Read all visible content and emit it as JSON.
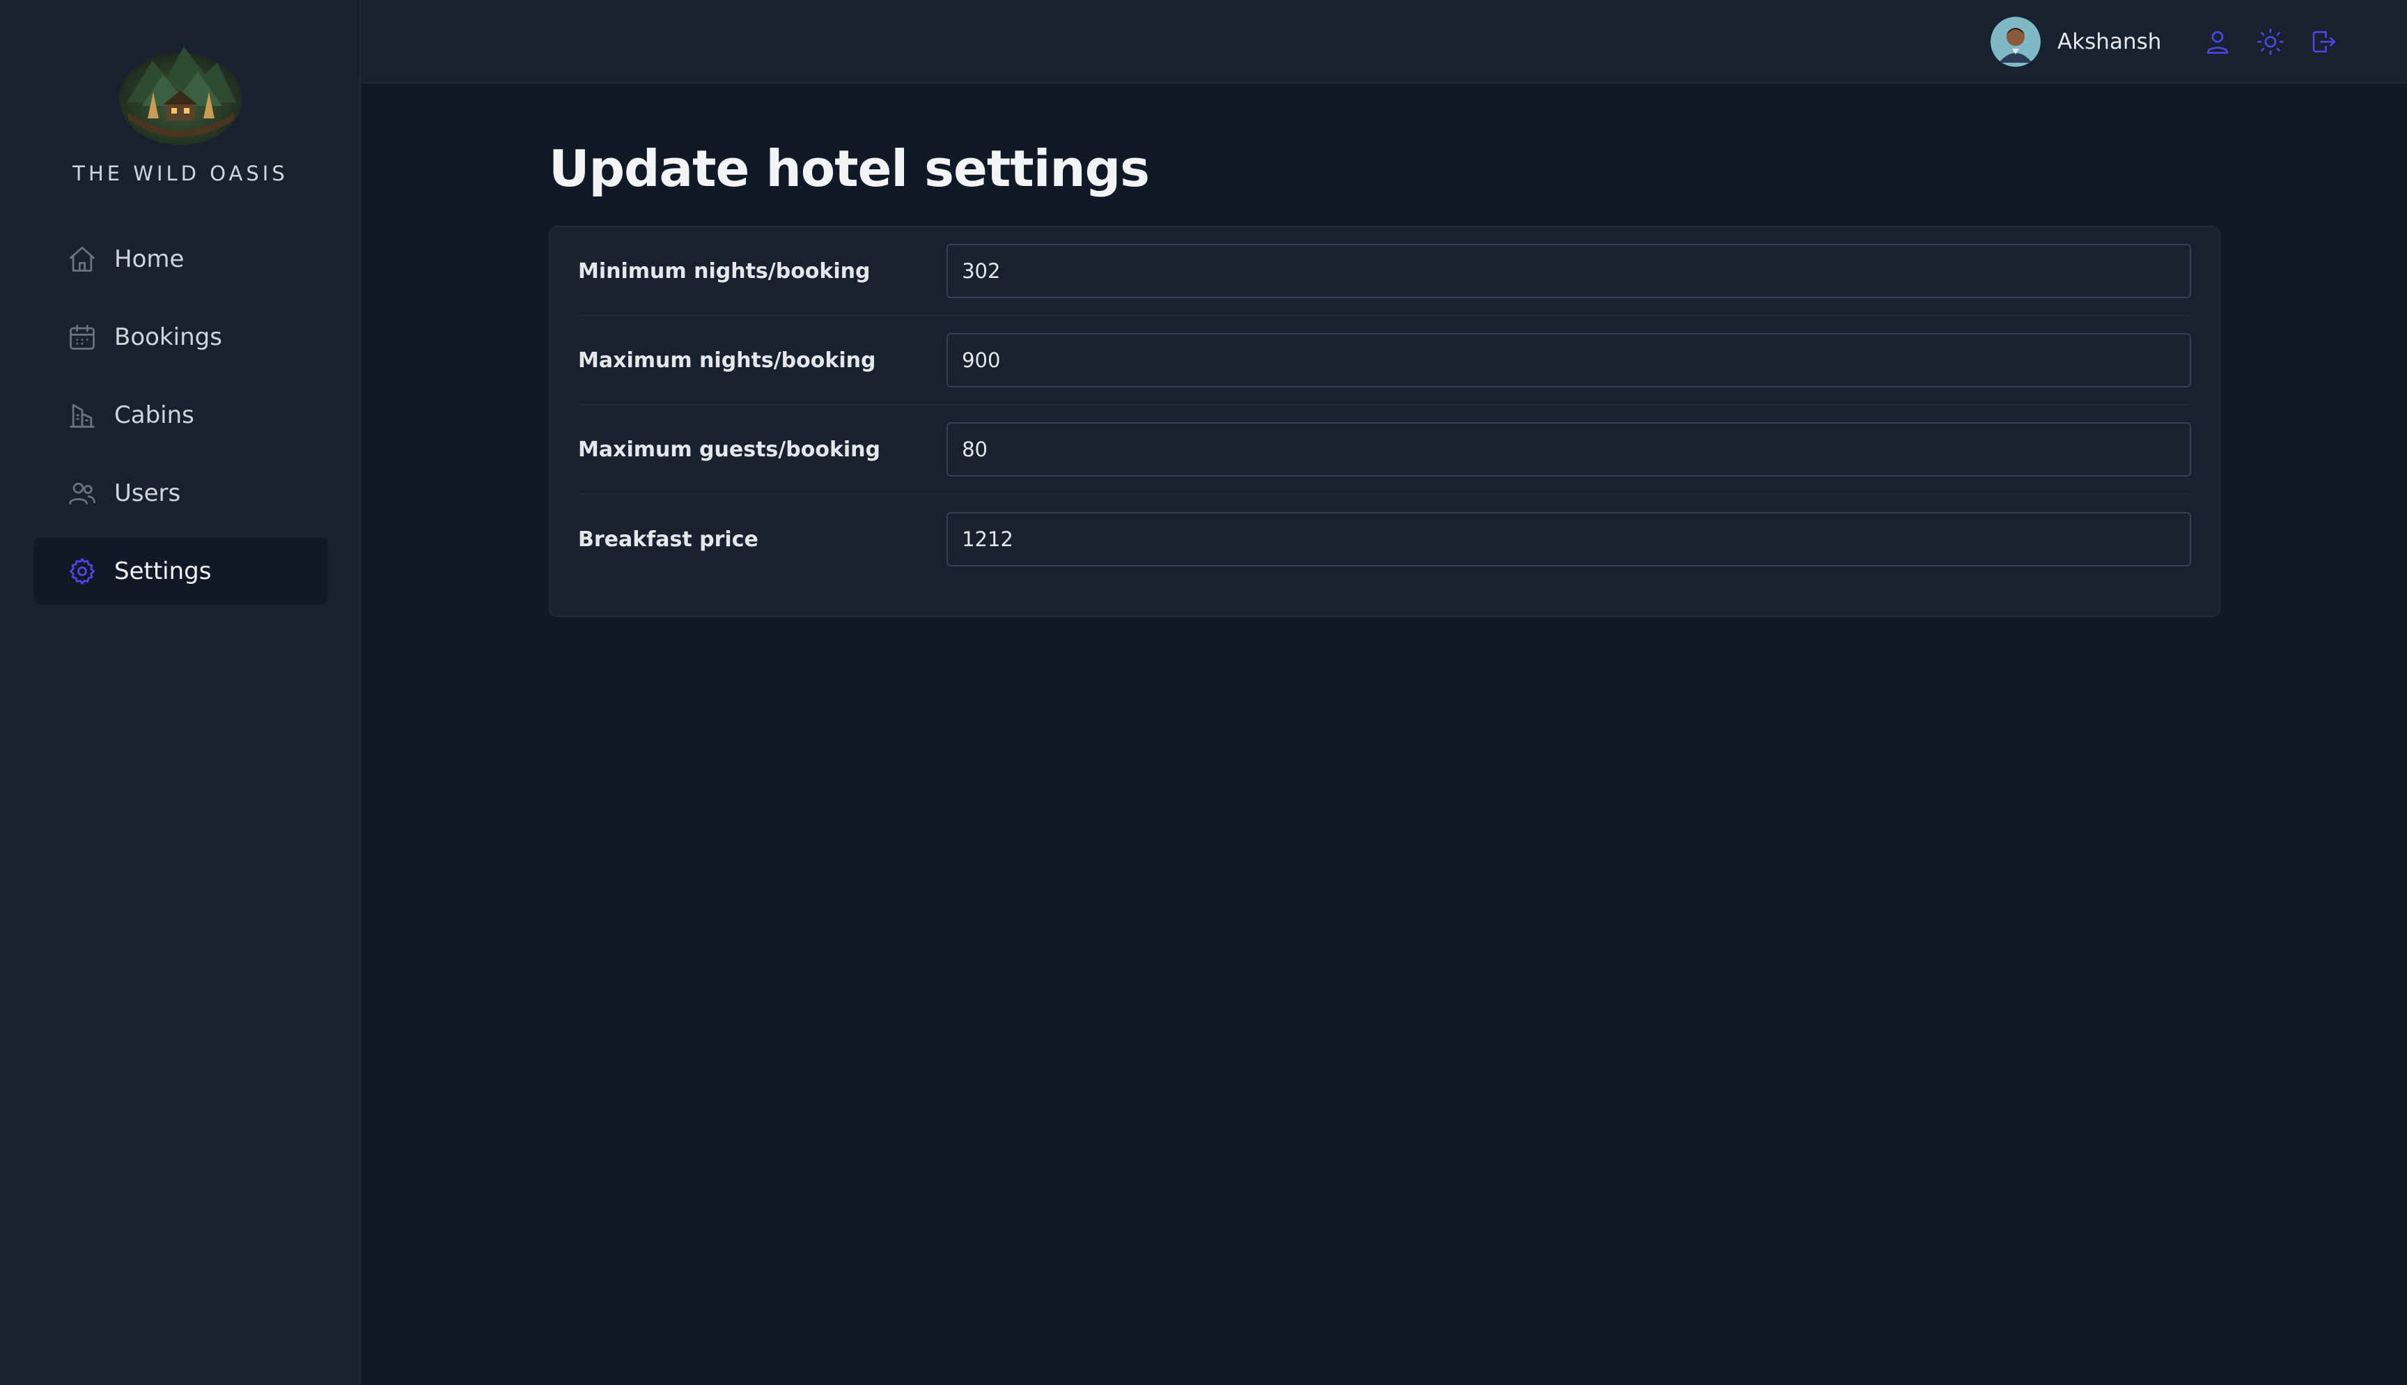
{
  "app": {
    "brand_name": "THE WILD OASIS",
    "accent_color": "#4f46e5"
  },
  "sidebar": {
    "items": [
      {
        "label": "Home",
        "icon": "home-icon",
        "active": false
      },
      {
        "label": "Bookings",
        "icon": "calendar-icon",
        "active": false
      },
      {
        "label": "Cabins",
        "icon": "cabins-icon",
        "active": false
      },
      {
        "label": "Users",
        "icon": "users-icon",
        "active": false
      },
      {
        "label": "Settings",
        "icon": "gear-icon",
        "active": true
      }
    ]
  },
  "header": {
    "user_name": "Akshansh",
    "actions": [
      "account-icon",
      "sun-icon",
      "logout-icon"
    ]
  },
  "main": {
    "title": "Update hotel settings",
    "fields": [
      {
        "label": "Minimum nights/booking",
        "value": "302"
      },
      {
        "label": "Maximum nights/booking",
        "value": "900"
      },
      {
        "label": "Maximum guests/booking",
        "value": "80"
      },
      {
        "label": "Breakfast price",
        "value": "1212"
      }
    ]
  }
}
